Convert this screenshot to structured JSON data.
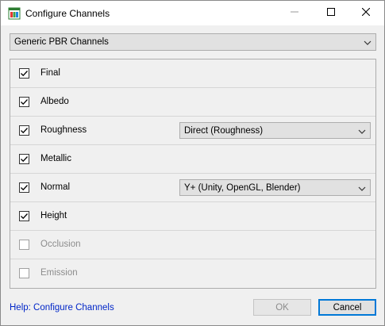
{
  "window": {
    "title": "Configure Channels"
  },
  "preset": {
    "label": "Generic PBR Channels"
  },
  "channels": [
    {
      "label": "Final",
      "checked": true,
      "enabled": true
    },
    {
      "label": "Albedo",
      "checked": true,
      "enabled": true
    },
    {
      "label": "Roughness",
      "checked": true,
      "enabled": true,
      "option": "Direct (Roughness)"
    },
    {
      "label": "Metallic",
      "checked": true,
      "enabled": true
    },
    {
      "label": "Normal",
      "checked": true,
      "enabled": true,
      "option": "Y+ (Unity, OpenGL, Blender)"
    },
    {
      "label": "Height",
      "checked": true,
      "enabled": true
    },
    {
      "label": "Occlusion",
      "checked": false,
      "enabled": false
    },
    {
      "label": "Emission",
      "checked": false,
      "enabled": false
    }
  ],
  "footer": {
    "help_link": "Help: Configure Channels",
    "ok_label": "OK",
    "cancel_label": "Cancel"
  },
  "icons": {
    "app": "app-icon",
    "minimize": "minimize-icon",
    "maximize": "maximize-icon",
    "close": "close-icon",
    "dropdown": "chevron-down-icon",
    "check": "check-icon"
  },
  "colors": {
    "link": "#0026c8",
    "focus_border": "#0078d7",
    "disabled_text": "#8c8c8c"
  }
}
